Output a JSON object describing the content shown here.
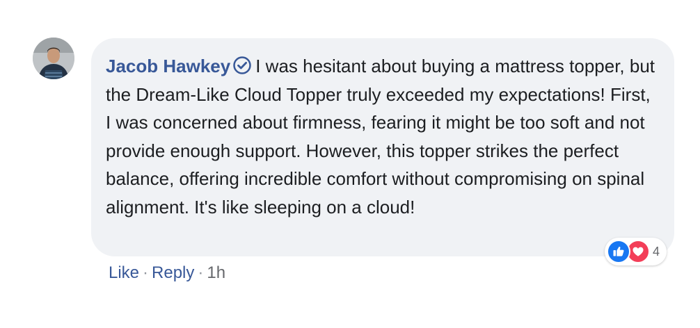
{
  "comment": {
    "author": "Jacob Hawkey",
    "verified_icon": "verified-badge-icon",
    "text": "I was hesitant about buying a mattress topper, but the Dream-Like Cloud Topper truly exceeded my expectations! First, I was concerned about firmness, fearing it might be too soft and not provide enough support. However, this topper strikes the perfect balance, offering incredible comfort without compromising on spinal alignment. It's like sleeping on a cloud!",
    "reactions": {
      "icons": [
        "like-icon",
        "love-icon"
      ],
      "count": "4"
    },
    "actions": {
      "like": "Like",
      "reply": "Reply",
      "separator": "·",
      "time": "1h"
    }
  },
  "colors": {
    "author": "#385898",
    "bubble": "#f0f2f5",
    "like": "#1877f2",
    "love": "#f33e58",
    "text": "#1c1e21"
  }
}
